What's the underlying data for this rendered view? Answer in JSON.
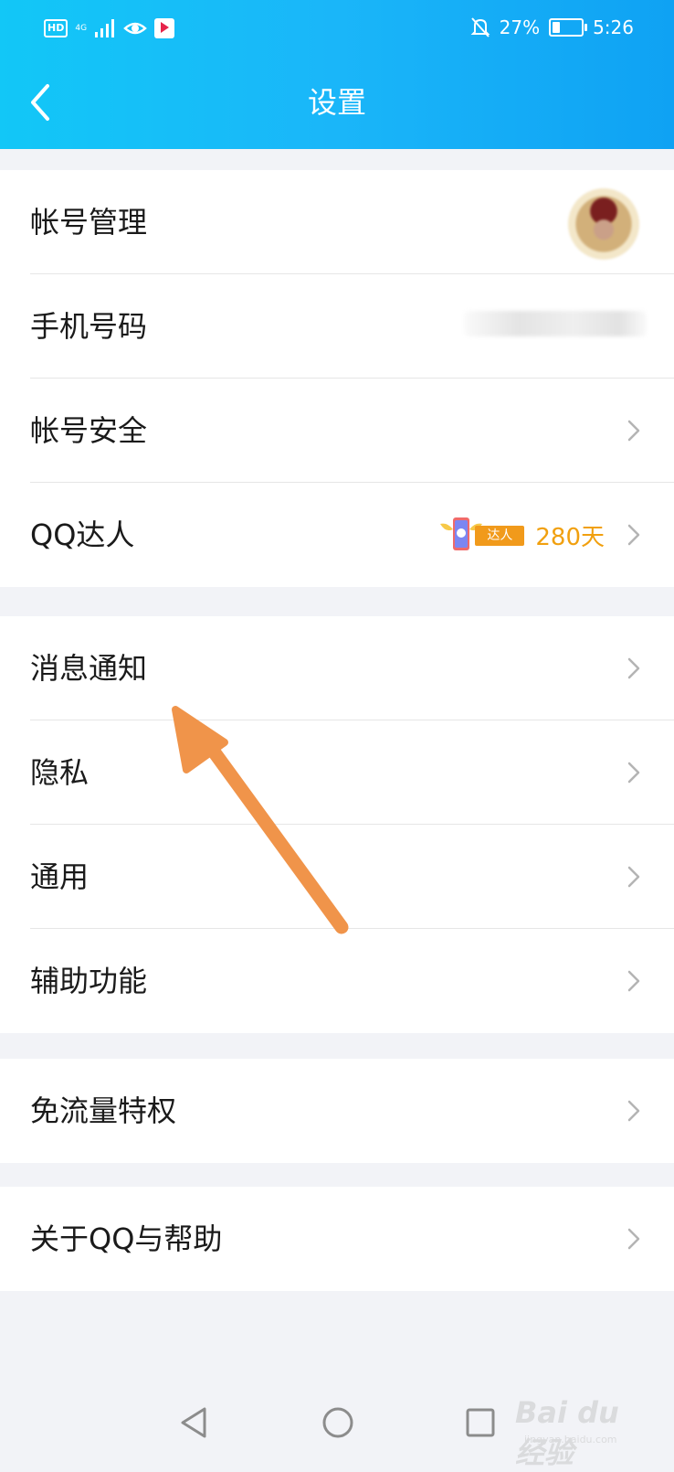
{
  "status_bar": {
    "left_badge": "HD",
    "network": "4G",
    "battery_text": "27%",
    "battery_level": 0.27,
    "time": "5:26"
  },
  "header": {
    "title": "设置",
    "back_icon": "chevron-left-icon"
  },
  "groups": [
    {
      "items": [
        {
          "label": "帐号管理",
          "trailing": "avatar"
        },
        {
          "label": "手机号码",
          "trailing": "masked-phone"
        },
        {
          "label": "帐号安全",
          "trailing": "chevron"
        },
        {
          "label": "QQ达人",
          "trailing": "badge",
          "badge_text": "达人",
          "days_text": "280天"
        }
      ]
    },
    {
      "items": [
        {
          "label": "消息通知"
        },
        {
          "label": "隐私"
        },
        {
          "label": "通用"
        },
        {
          "label": "辅助功能"
        }
      ]
    },
    {
      "items": [
        {
          "label": "免流量特权"
        }
      ]
    },
    {
      "items": [
        {
          "label": "关于QQ与帮助"
        }
      ]
    }
  ],
  "annotation": {
    "color": "#f0944a"
  },
  "nav_bar": {
    "back_icon": "triangle-back-icon",
    "home_icon": "circle-home-icon",
    "recents_icon": "square-recents-icon"
  },
  "watermark": {
    "text": "Bai du 经验",
    "sub": "jingyan.baidu.com"
  },
  "colors": {
    "header_start": "#12c7f7",
    "header_end": "#0fa2f3",
    "days": "#f1a00f",
    "badge": "#f19a1b"
  }
}
